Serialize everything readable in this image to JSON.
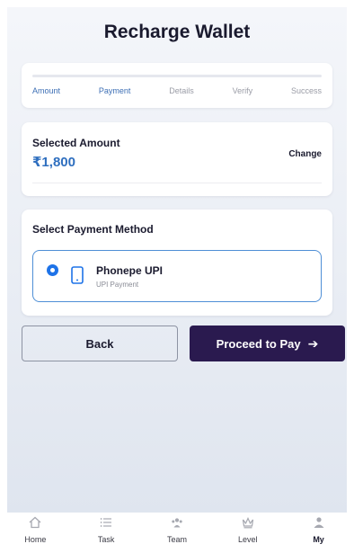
{
  "page": {
    "title": "Recharge Wallet"
  },
  "stepper": {
    "progress": 0.0,
    "steps": [
      {
        "label": "Amount",
        "active": true
      },
      {
        "label": "Payment",
        "active": true
      },
      {
        "label": "Details",
        "active": false
      },
      {
        "label": "Verify",
        "active": false
      },
      {
        "label": "Success",
        "active": false
      }
    ]
  },
  "amount": {
    "label": "Selected Amount",
    "value": "₹1,800",
    "change_label": "Change"
  },
  "payment": {
    "title": "Select Payment Method",
    "option": {
      "name": "Phonepe UPI",
      "sub": "UPI Payment",
      "selected": true,
      "icon": "phone-icon"
    }
  },
  "actions": {
    "back_label": "Back",
    "proceed_label": "Proceed to Pay",
    "proceed_arrow": "➔"
  },
  "nav": {
    "items": [
      {
        "label": "Home",
        "icon": "home-icon",
        "active": false
      },
      {
        "label": "Task",
        "icon": "task-icon",
        "active": false
      },
      {
        "label": "Team",
        "icon": "team-icon",
        "active": false
      },
      {
        "label": "Level",
        "icon": "crown-icon",
        "active": false
      },
      {
        "label": "My",
        "icon": "user-icon",
        "active": true
      }
    ]
  },
  "colors": {
    "accent": "#2f6fbf",
    "primary_button": "#2a1a4f",
    "active_step": "#3d6fb5",
    "radio": "#1e73e8",
    "option_border": "#4f8fd6"
  }
}
